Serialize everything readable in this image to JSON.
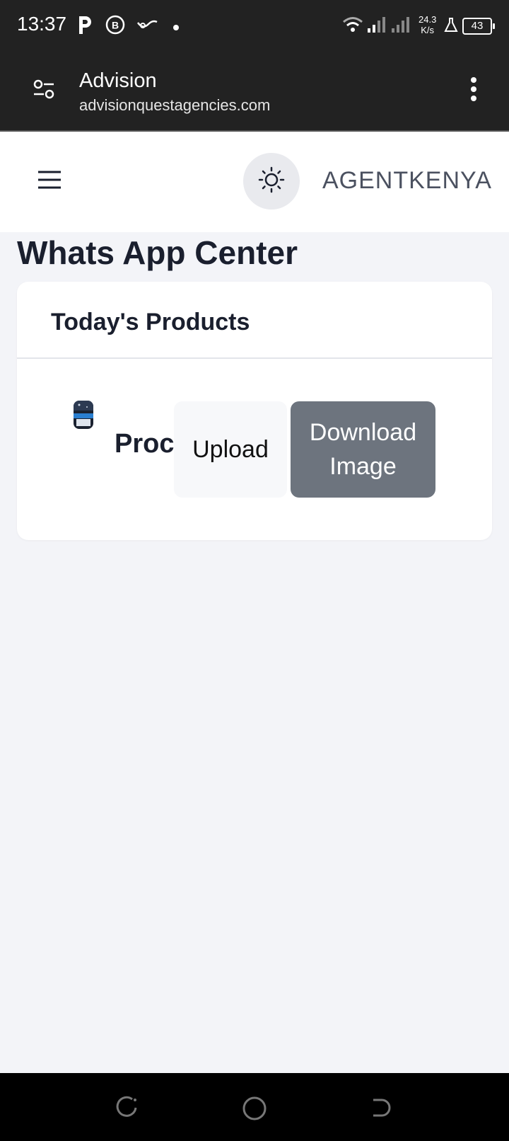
{
  "status_bar": {
    "time": "13:37",
    "net_speed_value": "24.3",
    "net_speed_unit": "K/s",
    "battery": "43",
    "icons": [
      "p-notification-icon",
      "business-chat-icon",
      "carrier-icon",
      "dot-icon",
      "wifi-icon",
      "signal-icon",
      "signal-icon",
      "lab-flask-icon",
      "battery-icon"
    ]
  },
  "browser": {
    "site_title": "Advision",
    "url": "advisionquestagencies.com"
  },
  "header": {
    "username": "AGENTKENYA"
  },
  "page": {
    "title": "Whats App Center"
  },
  "card": {
    "title": "Today's Products",
    "product_name": "Proc",
    "upload_label": "Upload",
    "download_label": "Download Image"
  },
  "colors": {
    "system_bar": "#222222",
    "page_bg": "#f3f4f8",
    "download_button": "#6d747e",
    "text_dark": "#1a1f2e"
  }
}
